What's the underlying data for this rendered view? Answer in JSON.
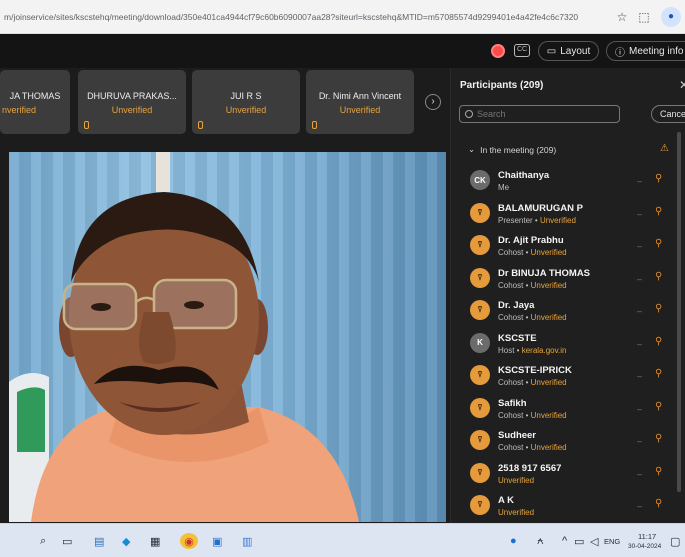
{
  "browser": {
    "url": "m/joinservice/sites/kscstehq/meeting/download/350e401ca4944cf79c60b6090007aa28?siteurl=kscstehq&MTID=m57085574d9299401e4a42fe4c6c7320"
  },
  "topbar": {
    "layout_label": "Layout",
    "meeting_info_label": "Meeting info"
  },
  "thumbnails": [
    {
      "name": "JA THOMAS",
      "status": "nverified"
    },
    {
      "name": "DHURUVA PRAKAS...",
      "status": "Unverified"
    },
    {
      "name": "JUI R S",
      "status": "Unverified"
    },
    {
      "name": "Dr. Nimi Ann Vincent",
      "status": "Unverified"
    }
  ],
  "participants": {
    "title": "Participants (209)",
    "search_placeholder": "Search",
    "cancel_label": "Cancel",
    "section_label": "In the meeting (209)",
    "items": [
      {
        "initials": "CK",
        "name": "Chaithanya",
        "role": "Me",
        "status": ""
      },
      {
        "initials": "",
        "name": "BALAMURUGAN P",
        "role": "Presenter",
        "status": "Unverified"
      },
      {
        "initials": "",
        "name": "Dr. Ajit Prabhu",
        "role": "Cohost",
        "status": "Unverified"
      },
      {
        "initials": "",
        "name": "Dr BINUJA THOMAS",
        "role": "Cohost",
        "status": "Unverified"
      },
      {
        "initials": "",
        "name": "Dr. Jaya",
        "role": "Cohost",
        "status": "Unverified"
      },
      {
        "initials": "K",
        "name": "KSCSTE",
        "role": "Host",
        "status": "kerala.gov.in"
      },
      {
        "initials": "",
        "name": "KSCSTE-IPRICK",
        "role": "Cohost",
        "status": "Unverified"
      },
      {
        "initials": "",
        "name": "Safikh",
        "role": "Cohost",
        "status": "Unverified"
      },
      {
        "initials": "",
        "name": "Sudheer",
        "role": "Cohost",
        "status": "Unverified"
      },
      {
        "initials": "",
        "name": "2518 917 6567",
        "role": "",
        "status": "Unverified"
      },
      {
        "initials": "",
        "name": "A K",
        "role": "",
        "status": "Unverified"
      }
    ]
  },
  "taskbar": {
    "lang": "ENG",
    "time": "11:17",
    "date": "30-04-2024"
  },
  "colors": {
    "accent_orange": "#e8a33a",
    "panel_bg": "#1f1f1f",
    "stage_bg": "#1c1c1c"
  }
}
